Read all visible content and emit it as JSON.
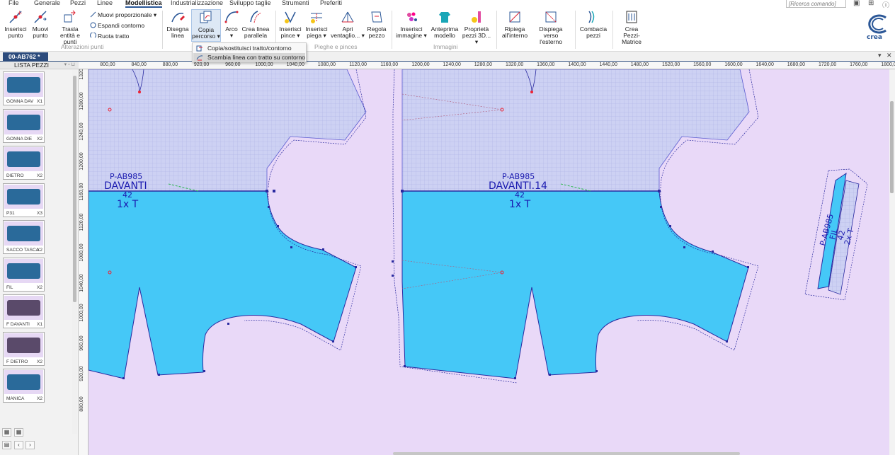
{
  "menu": {
    "items": [
      "File",
      "Generale",
      "Pezzi",
      "Linee",
      "Modellistica",
      "Industrializzazione",
      "Sviluppo taglie",
      "Strumenti",
      "Preferiti"
    ],
    "active": "Modellistica",
    "search_placeholder": "[Ricerca comando]"
  },
  "ribbon": {
    "buttons": {
      "inserisci_punto": "Inserisci punto",
      "muovi_punto": "Muovi punto",
      "trasla": "Trasla entità e punti",
      "muovi_prop": "Muovi proporzionale",
      "espandi": "Espandi contorno",
      "ruota": "Ruota tratto",
      "disegna_linea": "Disegna linea",
      "copia_percorso": "Copia percorso",
      "arco": "Arco",
      "crea_linea_parallela": "Crea linea parallela",
      "inserisci_pince": "Inserisci pince",
      "inserisci_piega": "Inserisci piega",
      "apri_ventaglio": "Apri ventaglio...",
      "regola_pezzo": "Regola pezzo",
      "inserisci_immagine": "Inserisci immagine",
      "anteprima_modello": "Anteprima modello",
      "proprieta_pezzi_3d": "Proprietà pezzi 3D...",
      "ripiega_interno": "Ripiega all'interno",
      "dispiega_esterno": "Dispiega verso l'esterno",
      "combacia_pezzi": "Combacia pezzi",
      "crea_pezzi_matrice": "Crea Pezzi-Matrice"
    },
    "groups": {
      "alterazioni": "Alterazioni punti",
      "pieghe": "Pieghe e pinces",
      "immagini": "Immagini"
    },
    "logo_text": "crea"
  },
  "dropdown": {
    "items": [
      "Copia/sostituisci tratto/contorno",
      "Scambia linea con tratto su contorno"
    ],
    "highlighted": 1
  },
  "doc_tab": "00-AB762 *",
  "piece_list": {
    "title": "LISTA PEZZI",
    "items": [
      {
        "name": "GONNA DAV",
        "qty": "X1"
      },
      {
        "name": "GONNA DIE",
        "qty": "X2"
      },
      {
        "name": "DIETRO",
        "qty": "X2"
      },
      {
        "name": "P31",
        "qty": "X3"
      },
      {
        "name": "SACCO TASCA",
        "qty": "X2"
      },
      {
        "name": "FIL",
        "qty": "X2"
      },
      {
        "name": "F DAVANTI",
        "qty": "X1"
      },
      {
        "name": "F DIETRO",
        "qty": "X2"
      },
      {
        "name": "MANICA",
        "qty": "X2"
      }
    ]
  },
  "rulers": {
    "x_labels": [
      "800,00",
      "840,00",
      "880,00",
      "920,00",
      "960,00",
      "1000,00",
      "1040,00",
      "1080,00",
      "1120,00",
      "1160,00",
      "1200,00",
      "1240,00",
      "1280,00",
      "1320,00",
      "1360,00",
      "1400,00",
      "1440,00",
      "1480,00",
      "1520,00",
      "1560,00",
      "1600,00",
      "1640,00",
      "1680,00",
      "1720,00",
      "1760,00",
      "1800,00"
    ],
    "y_labels": [
      "1320,00",
      "1280,00",
      "1240,00",
      "1200,00",
      "1160,00",
      "1120,00",
      "1080,00",
      "1040,00",
      "1000,00",
      "960,00",
      "920,00",
      "880,00"
    ]
  },
  "pieces_canvas": {
    "piece1": {
      "code": "P-AB985",
      "name": "DAVANTI",
      "size": "42",
      "qty": "1x T"
    },
    "piece2": {
      "code": "P-AB985",
      "name": "DAVANTI.14",
      "size": "42",
      "qty": "1x T"
    },
    "piece3": {
      "code": "P-AB985",
      "name": "FIL",
      "size": "42",
      "qty": "2x T"
    }
  },
  "colors": {
    "canvas_bg": "#e9d9f8",
    "piece_fill": "#45c8f7",
    "grid_fill": "#c9cff2",
    "outline": "#2a2aa0",
    "accent": "#2b5797"
  }
}
